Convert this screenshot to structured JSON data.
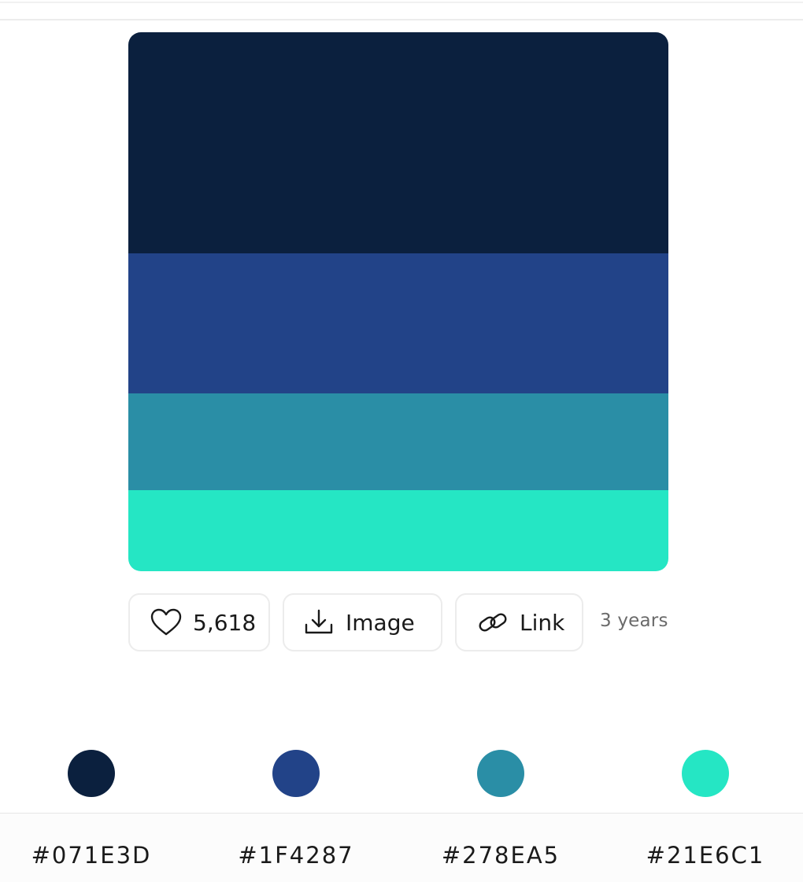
{
  "palette": {
    "colors": [
      {
        "hex": "#071E3D",
        "label": "#071E3D",
        "display": "#0B203E"
      },
      {
        "hex": "#1F4287",
        "label": "#1F4287",
        "display": "#224388"
      },
      {
        "hex": "#278EA5",
        "label": "#278EA5",
        "display": "#2A8EA6"
      },
      {
        "hex": "#21E6C1",
        "label": "#21E6C1",
        "display": "#25E6C4"
      }
    ],
    "stripe_fractions": [
      0.41,
      0.26,
      0.18,
      0.15
    ]
  },
  "actions": {
    "likes": "5,618",
    "image_label": "Image",
    "link_label": "Link",
    "time_ago": "3 years"
  },
  "icons": {
    "like": "heart-icon",
    "image": "download-icon",
    "link": "link-icon"
  }
}
